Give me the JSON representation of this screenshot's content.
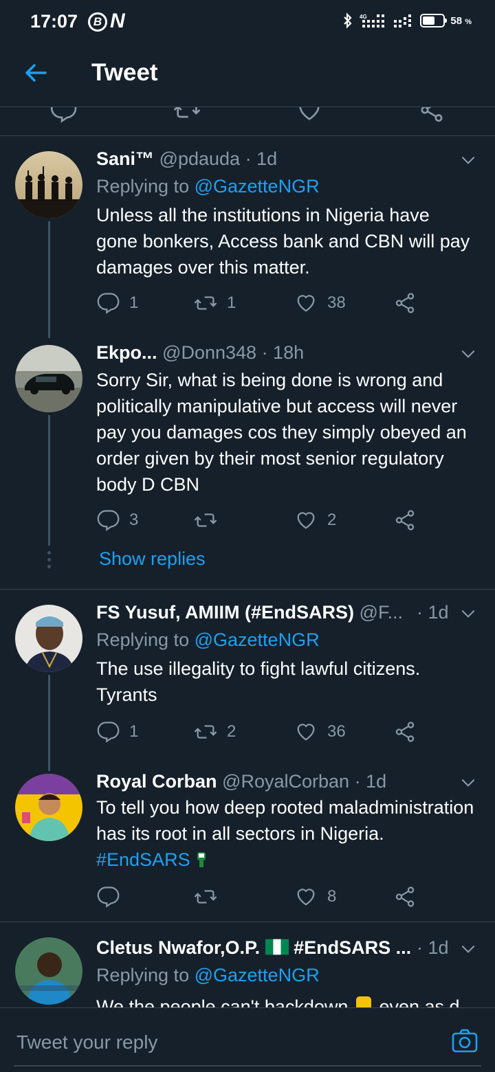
{
  "status_bar": {
    "time": "17:07",
    "battery": "58",
    "battery_unit": "%",
    "network": "4G"
  },
  "header": {
    "title": "Tweet"
  },
  "tweets": [
    {
      "name": "Sani™",
      "handle": "@pdauda",
      "time": "· 1d",
      "replying_label": "Replying to",
      "replying_to": "@GazetteNGR",
      "text": "Unless all the institutions in Nigeria have gone bonkers, Access bank and CBN will pay damages over this matter.",
      "replies": "1",
      "retweets": "1",
      "likes": "38"
    },
    {
      "name": "Ekpo...",
      "handle": "@Donn348",
      "time": "· 18h",
      "text": "Sorry Sir, what is being done is wrong and politically manipulative but access will never pay you damages cos they simply obeyed an order given by their most senior regulatory body D CBN",
      "replies": "3",
      "retweets": "",
      "likes": "2",
      "show_replies": "Show replies"
    },
    {
      "name": "FS Yusuf, AMIIM (#EndSARS)",
      "handle": "@F...",
      "time": "· 1d",
      "replying_label": "Replying to",
      "replying_to": "@GazetteNGR",
      "text": "The use illegality to fight lawful citizens. Tyrants",
      "replies": "1",
      "retweets": "2",
      "likes": "36"
    },
    {
      "name": "Royal Corban",
      "handle": "@RoyalCorban",
      "time": "· 1d",
      "text": "To tell you how deep rooted maladministration has its root in all sectors in Nigeria.",
      "hashtag": "#EndSARS",
      "replies": "",
      "retweets": "",
      "likes": "8"
    },
    {
      "name": "Cletus Nwafor,O.P.",
      "name_suffix": "#EndSARS ...",
      "time": "· 1d",
      "replying_label": "Replying to",
      "replying_to": "@GazetteNGR",
      "text": "We the people can't backdown",
      "text_tail": "even as d"
    }
  ],
  "composer": {
    "placeholder": "Tweet your reply"
  },
  "colors": {
    "background": "#15202b",
    "accent": "#1da1f2",
    "muted": "#8899a6",
    "divider": "#38444d"
  }
}
